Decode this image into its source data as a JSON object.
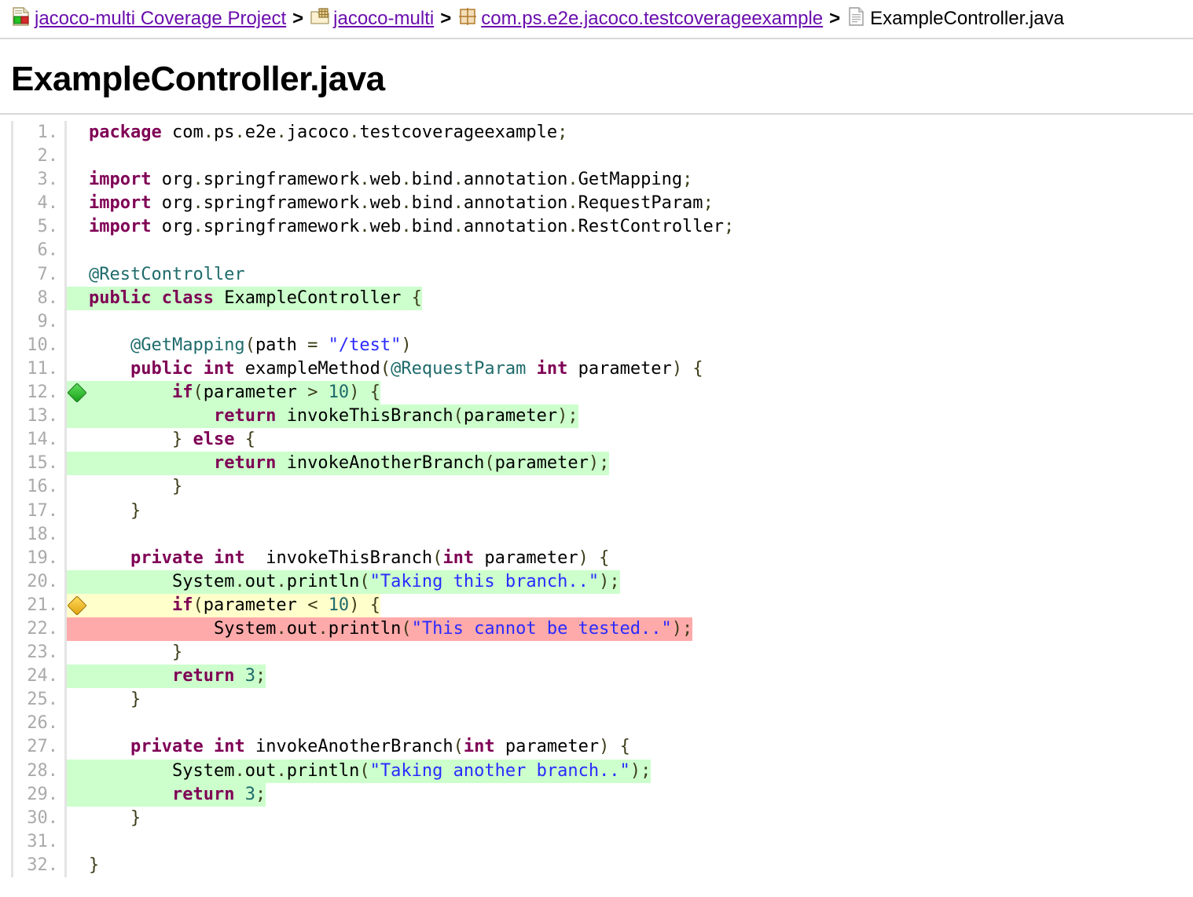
{
  "breadcrumb": {
    "items": [
      {
        "label": "jacoco-multi Coverage Project",
        "icon": "report-icon",
        "link": true
      },
      {
        "label": "jacoco-multi",
        "icon": "bundle-folder-icon",
        "link": true
      },
      {
        "label": "com.ps.e2e.jacoco.testcoverageexample",
        "icon": "package-icon",
        "link": true
      },
      {
        "label": "ExampleController.java",
        "icon": "source-file-icon",
        "link": false
      }
    ],
    "separator": ">"
  },
  "title": "ExampleController.java",
  "colors": {
    "covered": "#ccffcc",
    "uncovered": "#ffaaaa",
    "partial": "#ffffcc",
    "link": "#6a0dad",
    "keyword": "#7f0055",
    "annotation": "#1f6b6b",
    "string": "#2a2aff",
    "number": "#1f6b6b",
    "line_number": "#aaaaaa"
  },
  "source": {
    "lines": [
      {
        "n": "1.",
        "status": "none",
        "marker": "none"
      },
      {
        "n": "2.",
        "status": "none",
        "marker": "none"
      },
      {
        "n": "3.",
        "status": "none",
        "marker": "none"
      },
      {
        "n": "4.",
        "status": "none",
        "marker": "none"
      },
      {
        "n": "5.",
        "status": "none",
        "marker": "none"
      },
      {
        "n": "6.",
        "status": "none",
        "marker": "none"
      },
      {
        "n": "7.",
        "status": "none",
        "marker": "none"
      },
      {
        "n": "8.",
        "status": "covered",
        "marker": "none"
      },
      {
        "n": "9.",
        "status": "none",
        "marker": "none"
      },
      {
        "n": "10.",
        "status": "none",
        "marker": "none"
      },
      {
        "n": "11.",
        "status": "none",
        "marker": "none"
      },
      {
        "n": "12.",
        "status": "covered",
        "marker": "full-branch"
      },
      {
        "n": "13.",
        "status": "covered",
        "marker": "none"
      },
      {
        "n": "14.",
        "status": "none",
        "marker": "none"
      },
      {
        "n": "15.",
        "status": "covered",
        "marker": "none"
      },
      {
        "n": "16.",
        "status": "none",
        "marker": "none"
      },
      {
        "n": "17.",
        "status": "none",
        "marker": "none"
      },
      {
        "n": "18.",
        "status": "none",
        "marker": "none"
      },
      {
        "n": "19.",
        "status": "none",
        "marker": "none"
      },
      {
        "n": "20.",
        "status": "covered",
        "marker": "none"
      },
      {
        "n": "21.",
        "status": "partial",
        "marker": "partial-branch"
      },
      {
        "n": "22.",
        "status": "uncovered",
        "marker": "none"
      },
      {
        "n": "23.",
        "status": "none",
        "marker": "none"
      },
      {
        "n": "24.",
        "status": "covered",
        "marker": "none"
      },
      {
        "n": "25.",
        "status": "none",
        "marker": "none"
      },
      {
        "n": "26.",
        "status": "none",
        "marker": "none"
      },
      {
        "n": "27.",
        "status": "none",
        "marker": "none"
      },
      {
        "n": "28.",
        "status": "covered",
        "marker": "none"
      },
      {
        "n": "29.",
        "status": "covered",
        "marker": "none"
      },
      {
        "n": "30.",
        "status": "none",
        "marker": "none"
      },
      {
        "n": "31.",
        "status": "none",
        "marker": "none"
      },
      {
        "n": "32.",
        "status": "none",
        "marker": "none"
      }
    ],
    "code": {
      "l1": "package com.ps.e2e.jacoco.testcoverageexample;",
      "l2": "",
      "l3": "import org.springframework.web.bind.annotation.GetMapping;",
      "l4": "import org.springframework.web.bind.annotation.RequestParam;",
      "l5": "import org.springframework.web.bind.annotation.RestController;",
      "l6": "",
      "l7": "@RestController",
      "l8": "public class ExampleController {",
      "l9": "",
      "l10": "    @GetMapping(path = \"/test\")",
      "l11": "    public int exampleMethod(@RequestParam int parameter) {",
      "l12": "        if(parameter > 10) {",
      "l13": "            return invokeThisBranch(parameter);",
      "l14": "        } else {",
      "l15": "            return invokeAnotherBranch(parameter);",
      "l16": "        }",
      "l17": "    }",
      "l18": "",
      "l19": "    private int  invokeThisBranch(int parameter) {",
      "l20": "        System.out.println(\"Taking this branch..\");",
      "l21": "        if(parameter < 10) {",
      "l22": "            System.out.println(\"This cannot be tested..\");",
      "l23": "        }",
      "l24": "        return 3;",
      "l25": "    }",
      "l26": "",
      "l27": "    private int invokeAnotherBranch(int parameter) {",
      "l28": "        System.out.println(\"Taking another branch..\");",
      "l29": "        return 3;",
      "l30": "    }",
      "l31": "",
      "l32": "}"
    }
  }
}
